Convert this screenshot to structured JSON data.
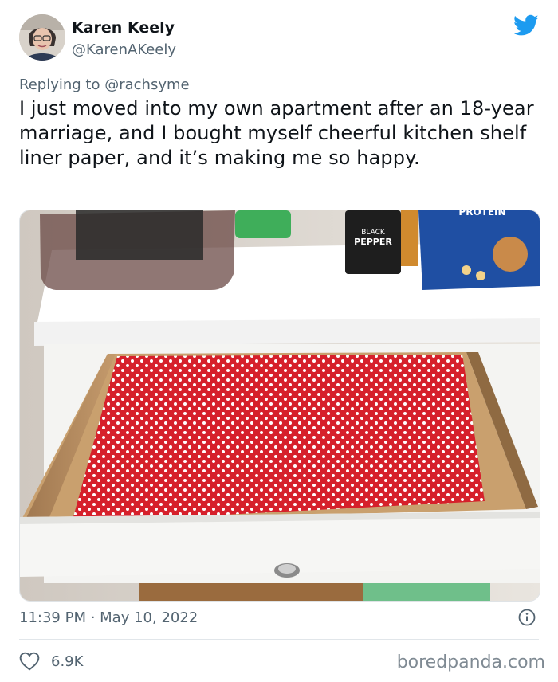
{
  "user": {
    "name": "Karen Keely",
    "handle": "@KarenAKeely"
  },
  "reply": {
    "prefix": "Replying to ",
    "handle": "@rachsyme"
  },
  "tweet": {
    "text": "I just moved into my own apartment after an 18-year marriage, and I bought myself cheerful kitchen shelf liner paper, and it’s making me so happy."
  },
  "media": {
    "pepper_label_1": "BLACK",
    "pepper_label_2": "PEPPER",
    "box_label": "PROTEIN"
  },
  "meta": {
    "time": "11:39 PM",
    "separator": " · ",
    "date": "May 10, 2022"
  },
  "engagement": {
    "likes": "6.9K"
  },
  "watermark": "boredpanda.com",
  "colors": {
    "twitter_blue": "#1d9bf0",
    "liner_red": "#d6202b",
    "muted_text": "#536471"
  }
}
